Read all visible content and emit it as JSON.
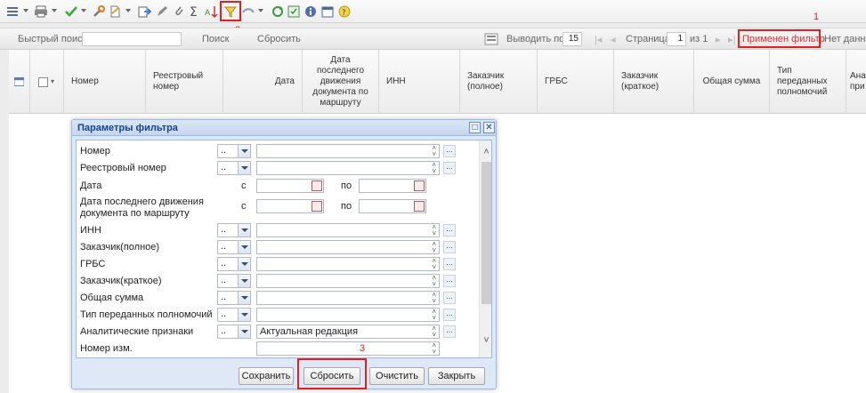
{
  "toolbar": {
    "icons": [
      "list-icon",
      "print-icon",
      "check-icon",
      "tools-icon",
      "document-icon",
      "export-icon",
      "edit-icon",
      "attach-icon",
      "sum-icon",
      "sort-icon",
      "filter-icon",
      "link-icon",
      "refresh-icon",
      "save-icon",
      "info-icon",
      "calendar-icon",
      "help-icon"
    ]
  },
  "pager": {
    "quick_search_label": "Быстрый поиск",
    "quick_search_value": "",
    "search_button": "Поиск",
    "reset_button": "Сбросить",
    "per_page_label": "Выводить по",
    "per_page_value": "15",
    "page_label": "Страница",
    "page_value": "1",
    "of_pages": "из 1",
    "filter_applied": "Применен фильтр",
    "no_data": "Нет данных"
  },
  "grid": {
    "columns": [
      "Номер",
      "Реестровый номер",
      "Дата",
      "Дата последнего движения документа по маршруту",
      "ИНН",
      "Заказчик (полное)",
      "ГРБС",
      "Заказчик (краткое)",
      "Общая сумма",
      "Тип переданных полномочий",
      "Ана при"
    ]
  },
  "dialog": {
    "title": "Параметры фильтра",
    "fields": [
      {
        "label": "Номер",
        "op": "..",
        "value": ""
      },
      {
        "label": "Реестровый номер",
        "op": "..",
        "value": ""
      },
      {
        "label": "Дата",
        "from_label": "с",
        "to_label": "по"
      },
      {
        "label": "Дата последнего движения документа по маршруту",
        "from_label": "с",
        "to_label": "по"
      },
      {
        "label": "ИНН",
        "op": "..",
        "value": ""
      },
      {
        "label": "Заказчик(полное)",
        "op": "..",
        "value": ""
      },
      {
        "label": "ГРБС",
        "op": "..",
        "value": ""
      },
      {
        "label": "Заказчик(краткое)",
        "op": "..",
        "value": ""
      },
      {
        "label": "Общая сумма",
        "op": "..",
        "value": ""
      },
      {
        "label": "Тип переданных полномочий",
        "op": "..",
        "value": ""
      },
      {
        "label": "Аналитические признаки",
        "op": "..",
        "value": "Актуальная редакция"
      },
      {
        "label": "Номер изм.",
        "value": ""
      }
    ],
    "buttons": {
      "save": "Сохранить",
      "reset": "Сбросить",
      "clear": "Очистить",
      "close": "Закрыть"
    }
  },
  "annotations": {
    "n1": "1",
    "n2": "2",
    "n3": "3"
  },
  "colors": {
    "highlight": "#e02020",
    "filter_text": "#e03030",
    "dialog_title": "#15428b",
    "dialog_bg": "#dfe8f6"
  }
}
